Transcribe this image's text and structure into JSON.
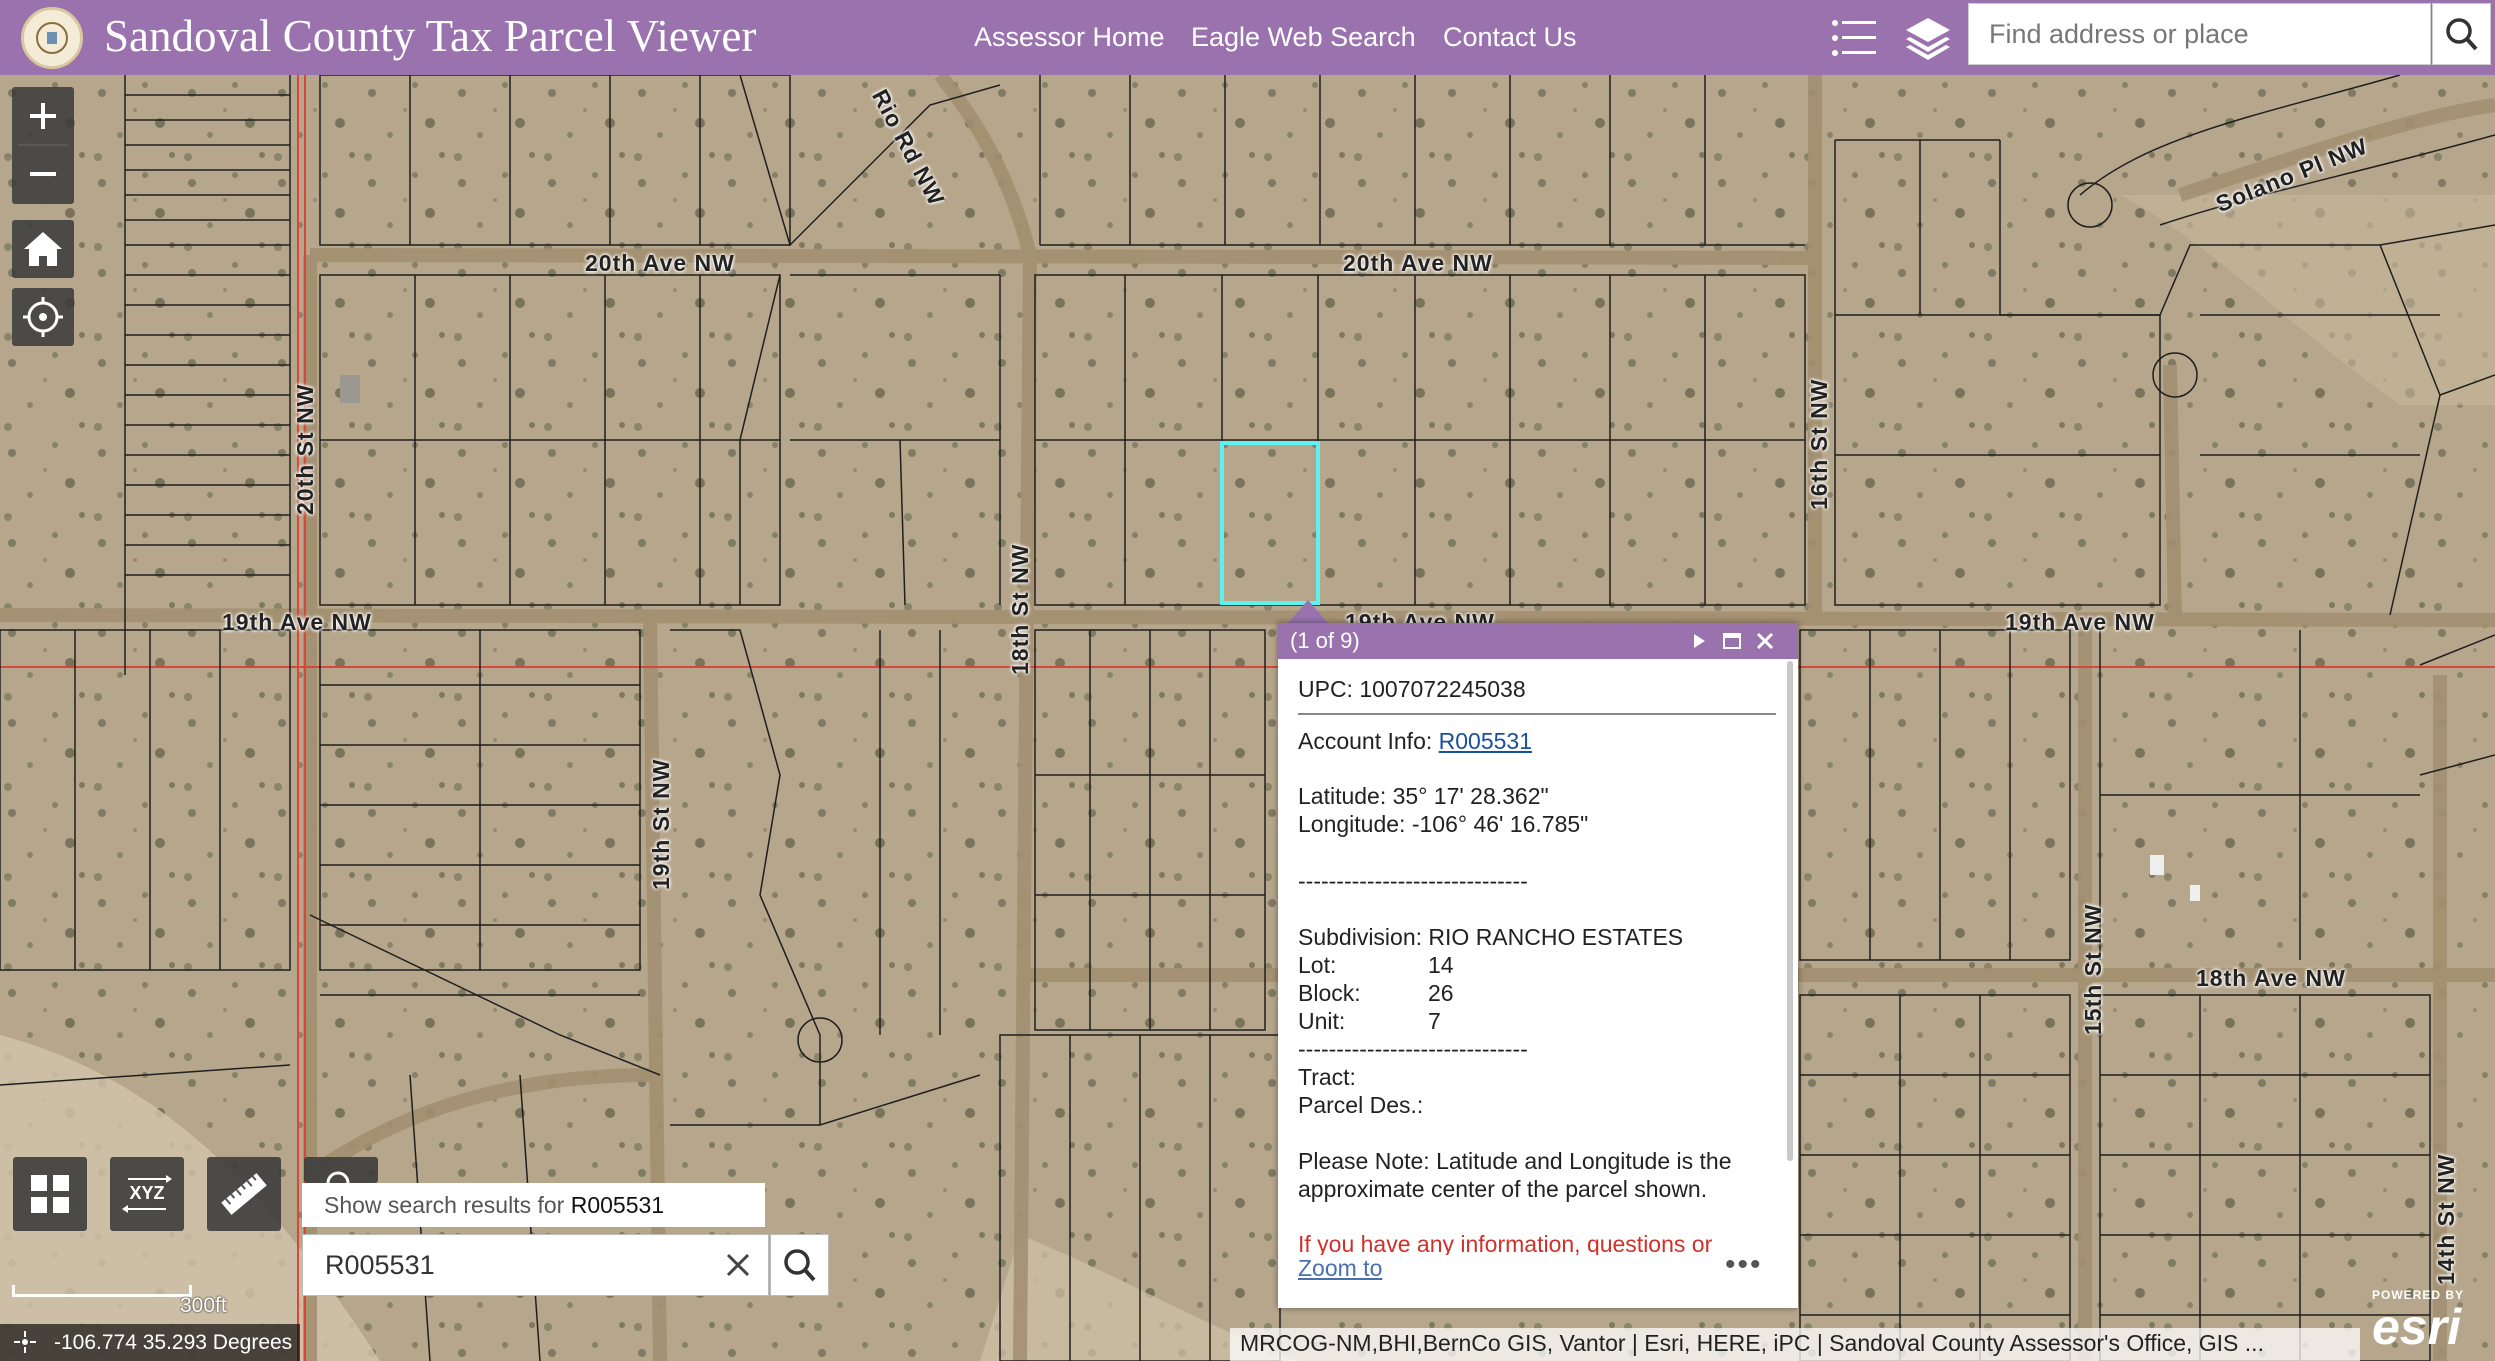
{
  "header": {
    "title": "Sandoval County Tax Parcel Viewer",
    "nav": [
      "Assessor Home",
      "Eagle Web Search",
      "Contact Us"
    ],
    "search_placeholder": "Find address or place",
    "bg_color": "#9a73ae"
  },
  "icons": {
    "list": "list-icon",
    "layers": "layers-icon",
    "search": "search-icon",
    "zoom_in": "plus-icon",
    "zoom_out": "minus-icon",
    "home": "home-icon",
    "locate": "locate-icon",
    "basemap": "grid-icon",
    "xyz": "xyz-icon",
    "measure": "ruler-icon",
    "clear": "close-icon"
  },
  "map": {
    "road_labels": [
      "20th Ave NW",
      "20th Ave NW",
      "19th Ave NW",
      "19th Ave NW",
      "19th Ave NW",
      "18th Ave NW",
      "Solano Pl NW",
      "20th St NW",
      "18th St NW",
      "19th St NW",
      "16th St NW",
      "15th St NW",
      "14th St NW",
      "Rio Rd NW"
    ],
    "parcel_highlight_color": "#5ff0f0"
  },
  "xyz_label": "XYZ",
  "search": {
    "hint_prefix": "Show search results for",
    "hint_value": "R005531",
    "value": "R005531"
  },
  "scale_label": "300ft",
  "coords": "-106.774 35.293 Degrees",
  "attribution": "MRCOG-NM,BHI,BernCo GIS, Vantor | Esri, HERE, iPC | Sandoval County Assessor's Office, GIS ...",
  "esri": {
    "powered": "POWERED BY",
    "wordmark": "esri"
  },
  "popup": {
    "count": "(1 of 9)",
    "upc": "UPC: 1007072245038",
    "account_label": "Account Info:",
    "account_link": "R005531",
    "latitude": "Latitude: 35° 17' 28.362\"",
    "longitude": "Longitude: -106° 46' 16.785\"",
    "divider": "------------------------------",
    "subdivision": "Subdivision: RIO RANCHO ESTATES",
    "fields": [
      {
        "k": "Lot:",
        "v": "14"
      },
      {
        "k": "Block:",
        "v": "26"
      },
      {
        "k": "Unit:",
        "v": "7"
      }
    ],
    "divider2": "------------------------------",
    "tract": "Tract:",
    "parcel_des": "Parcel Des.:",
    "note1": "Please Note: Latitude and Longitude is the",
    "note2": "approximate center of the parcel shown.",
    "info_text": "If you have any information, questions or",
    "zoom_to": "Zoom to",
    "more": "•••"
  }
}
